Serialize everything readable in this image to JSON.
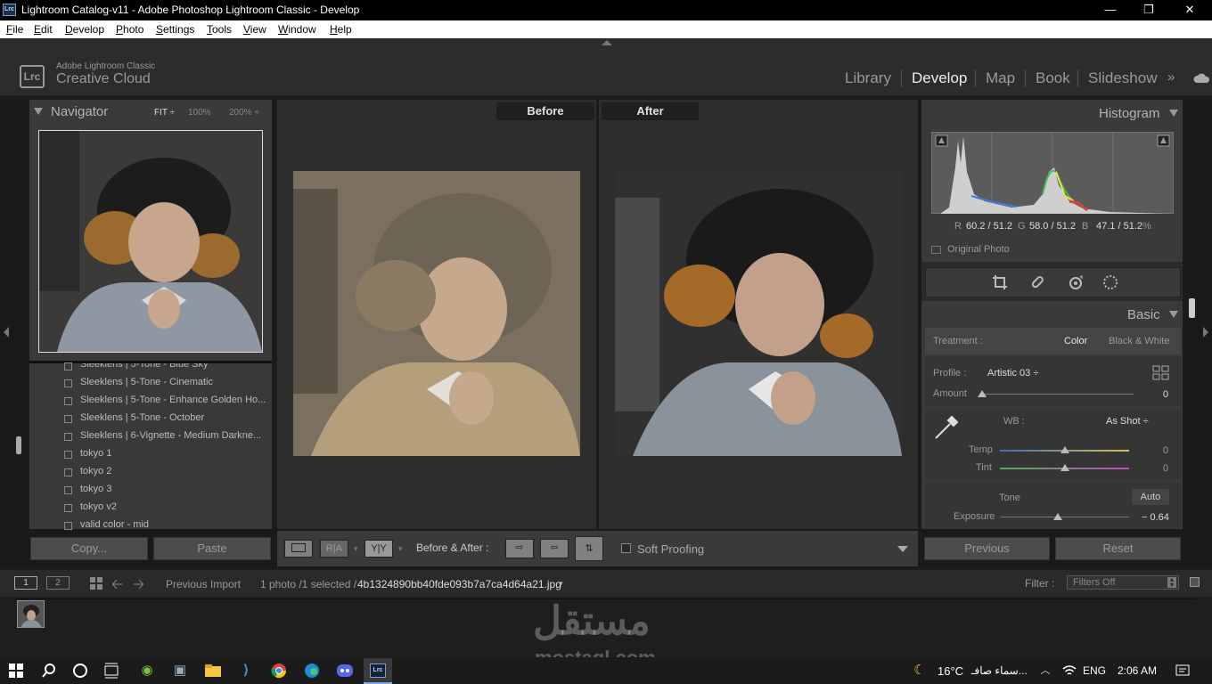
{
  "window": {
    "title": "Lightroom Catalog-v11 - Adobe Photoshop Lightroom Classic - Develop",
    "icon_text": "Lrc",
    "controls": [
      "minimize-icon",
      "maximize-icon",
      "close-icon"
    ]
  },
  "menu": [
    "File",
    "Edit",
    "Develop",
    "Photo",
    "Settings",
    "Tools",
    "View",
    "Window",
    "Help"
  ],
  "brand": {
    "logo": "Lrc",
    "line1": "Adobe Lightroom Classic",
    "line2": "Creative Cloud"
  },
  "modules": [
    "Library",
    "Develop",
    "Map",
    "Book",
    "Slideshow"
  ],
  "module_more": "»",
  "navigator": {
    "title": "Navigator",
    "fit": "FIT ÷",
    "zoom1": "100%",
    "zoom2": "200% ÷"
  },
  "presets": [
    "Sleeklens | 5-Tone - Blue Sky",
    "Sleeklens | 5-Tone - Cinematic",
    "Sleeklens | 5-Tone - Enhance Golden Ho...",
    "Sleeklens | 5-Tone - October",
    "Sleeklens | 6-Vignette - Medium Darkne...",
    "tokyo 1",
    "tokyo 2",
    "tokyo 3",
    "tokyo v2",
    "valid color - mid"
  ],
  "left_buttons": {
    "copy": "Copy...",
    "paste": "Paste"
  },
  "compare": {
    "before": "Before",
    "after": "After"
  },
  "toolbar": {
    "ra": "R|A",
    "yy": "Y|Y",
    "label": "Before & After :",
    "soft_proofing": "Soft Proofing"
  },
  "histogram": {
    "title": "Histogram",
    "r_label": "R",
    "r_val": "60.2 / 51.2",
    "g_label": "G",
    "g_val": "58.0 / 51.2",
    "b_label": "B",
    "b_val": "47.1 / 51.2",
    "pct": "%",
    "original": "Original Photo"
  },
  "basic": {
    "title": "Basic",
    "treatment_label": "Treatment :",
    "treatment_color": "Color",
    "treatment_bw": "Black & White",
    "profile_label": "Profile :",
    "profile_value": "Artistic 03 ÷",
    "amount_label": "Amount",
    "amount_value": "0",
    "amount_level": 0,
    "wb_label": "WB :",
    "wb_value": "As Shot ÷",
    "temp_label": "Temp",
    "temp_value": "0",
    "temp_level": 0.5,
    "tint_label": "Tint",
    "tint_value": "0",
    "tint_level": 0.5,
    "tone_label": "Tone",
    "auto_label": "Auto",
    "exposure_label": "Exposure",
    "exposure_value": "− 0.64",
    "exposure_level": 0.45
  },
  "right_buttons": {
    "previous": "Previous",
    "reset": "Reset"
  },
  "filmbar": {
    "view1": "1",
    "view2": "2",
    "source": "Previous Import",
    "count": "1 photo /1 selected /",
    "filename": "4b1324890bb40fde093b7a7ca4d64a21.jpg",
    "filter_label": "Filter :",
    "filter_value": "Filters Off"
  },
  "taskbar": {
    "temp": "16°C",
    "weather": "سماء صافـ...",
    "lang": "ENG",
    "time": "2:06 AM"
  },
  "watermark": {
    "arabic": "مستقل",
    "latin": "mostaql.com"
  },
  "colors": {
    "accent": "#e4e4e4",
    "panel": "#2b2b2b",
    "highlight_red": "#d94040",
    "highlight_yellow": "#f2e14a"
  }
}
